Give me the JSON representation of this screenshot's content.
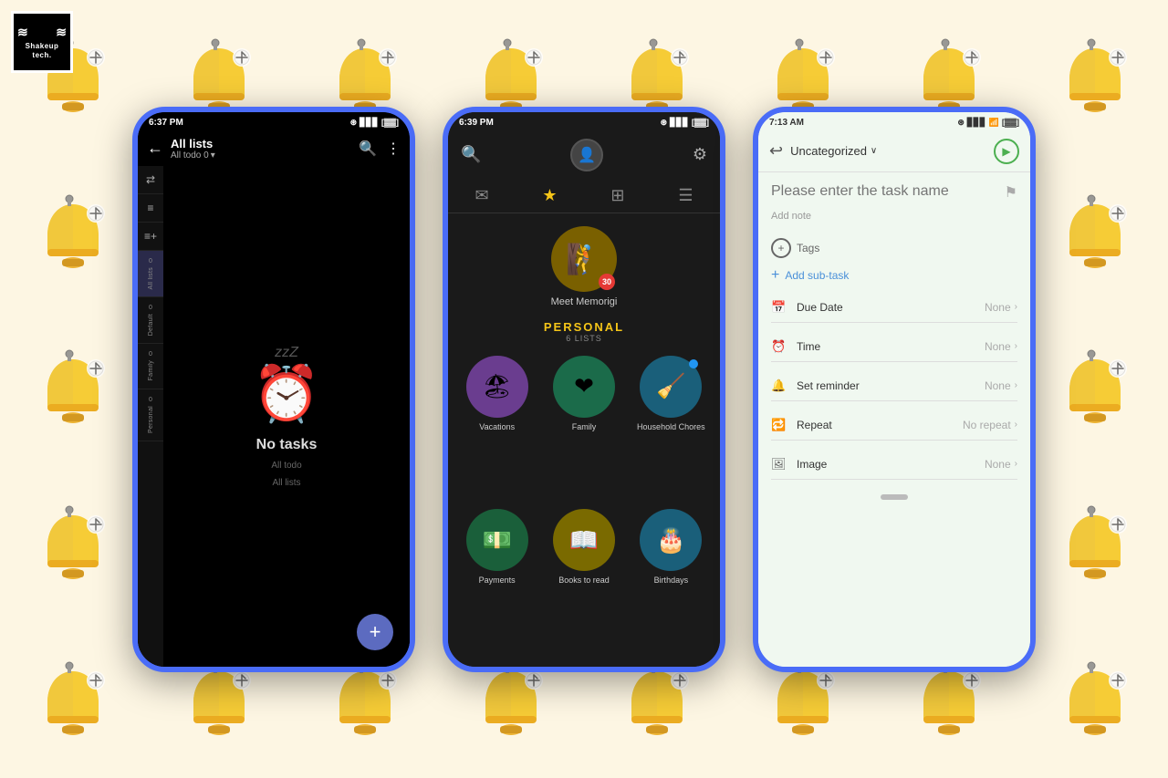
{
  "background": {
    "color": "#fdf6e3"
  },
  "logo": {
    "text": "Shakeup tech.",
    "squiggle_left": "≋",
    "squiggle_right": "≋"
  },
  "phone1": {
    "status_bar": {
      "time": "6:37 PM",
      "alarm_icon": "⏰",
      "bt_icon": "🔵",
      "signal": "▊▊▊",
      "battery": "▓"
    },
    "header": {
      "back_label": "←",
      "title": "All lists",
      "subtitle": "All todo  0",
      "search_label": "🔍",
      "more_label": "⋮"
    },
    "sidebar_tabs": [
      {
        "icon": "→|",
        "label": ""
      },
      {
        "icon": "≡",
        "label": ""
      },
      {
        "icon": "≡+",
        "label": ""
      },
      {
        "num": "0",
        "label": "All lists",
        "active": true
      },
      {
        "num": "0",
        "label": "Default"
      },
      {
        "num": "0",
        "label": "Family"
      },
      {
        "num": "0",
        "label": "Personal"
      }
    ],
    "empty_state": {
      "zzz": "zzZ",
      "alarm_emoji": "⏰",
      "title": "No tasks",
      "subtitle1": "All todo",
      "subtitle2": "All lists"
    },
    "fab_label": "+"
  },
  "phone2": {
    "status_bar": {
      "time": "6:39 PM",
      "alarm_icon": "⏰",
      "bt_icon": "🔵",
      "signal": "▊▊▊",
      "battery": "▓"
    },
    "nav_icons": [
      {
        "name": "inbox",
        "symbol": "✉",
        "active": false
      },
      {
        "name": "favorites",
        "symbol": "★",
        "active": true
      },
      {
        "name": "calendar",
        "symbol": "⊞",
        "active": false
      },
      {
        "name": "list",
        "symbol": "☰",
        "active": false
      }
    ],
    "featured": {
      "emoji": "🧗",
      "badge": "30",
      "label": "Meet Memorigi"
    },
    "personal_section": {
      "title": "PERSONAL",
      "count": "6 LISTS"
    },
    "lists": [
      {
        "name": "Vacations",
        "emoji": "🏖",
        "class": "vacations",
        "dot": false
      },
      {
        "name": "Family",
        "emoji": "❤",
        "class": "family",
        "dot": false
      },
      {
        "name": "Household Chores",
        "emoji": "🧹",
        "class": "household",
        "dot": true
      },
      {
        "name": "Payments",
        "emoji": "💵",
        "class": "payments",
        "dot": false
      },
      {
        "name": "Books to read",
        "emoji": "📖",
        "class": "books",
        "dot": false
      },
      {
        "name": "Birthdays",
        "emoji": "🎂",
        "class": "birthdays",
        "dot": false
      }
    ]
  },
  "phone3": {
    "status_bar": {
      "time": "7:13 AM",
      "icons": "⏰ 🔵 ▊▊▊ 📶 ▓"
    },
    "header": {
      "back_label": "↩",
      "category": "Uncategorized",
      "dropdown": "∨",
      "play_symbol": "▶"
    },
    "body": {
      "task_placeholder": "Please enter the task name",
      "note_placeholder": "Add note",
      "tags_label": "Tags",
      "add_subtask_label": "Add sub-task"
    },
    "properties": [
      {
        "icon": "📅",
        "label": "Due Date",
        "value": "None"
      },
      {
        "icon": "⏰",
        "label": "Time",
        "value": "None"
      },
      {
        "icon": "🔔",
        "label": "Set reminder",
        "value": "None"
      },
      {
        "icon": "🔁",
        "label": "Repeat",
        "value": "No repeat"
      },
      {
        "icon": "🖼",
        "label": "Image",
        "value": "None"
      }
    ]
  }
}
